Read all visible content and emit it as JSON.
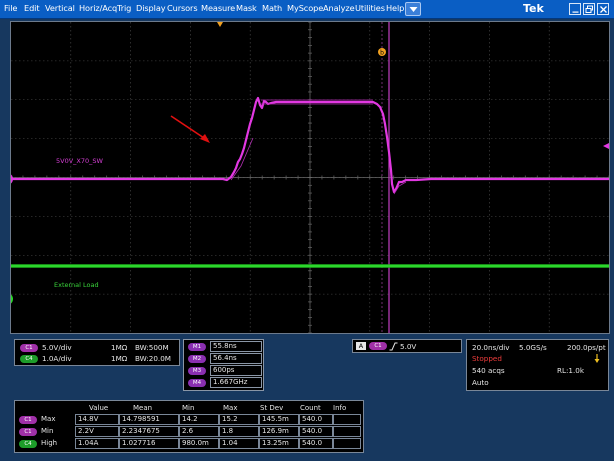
{
  "menu": {
    "items": [
      "File",
      "Edit",
      "Vertical",
      "Horiz/Acq",
      "Trig",
      "Display",
      "Cursors",
      "Measure",
      "Mask",
      "Math",
      "MyScope",
      "Analyze",
      "Utilities",
      "Help"
    ],
    "logo": "Tek"
  },
  "screen": {
    "ch1_label": "5V0V_X70_SW",
    "ch4_label": "External Load",
    "trigger_marker": "T",
    "cursor_marker": "b",
    "ch1_marker": "1",
    "ch4_marker": "4",
    "colors": {
      "ch1": "#e238e2",
      "ch4": "#2cd62c",
      "grid": "#5a5a5a",
      "cursor": "#b53ab5"
    }
  },
  "channels": [
    {
      "badge": "C1",
      "scale": "5.0V/div",
      "impedance": "1MΩ",
      "bandwidth": "BW:500M"
    },
    {
      "badge": "C4",
      "scale": "1.0A/div",
      "impedance": "1MΩ",
      "bandwidth": "BW:20.0M"
    }
  ],
  "measurements": [
    {
      "badge": "M1",
      "value": "55.8ns"
    },
    {
      "badge": "M2",
      "value": "56.4ns"
    },
    {
      "badge": "M3",
      "value": "600ps"
    },
    {
      "badge": "M4",
      "value": "1.667GHz"
    }
  ],
  "trigger": {
    "source": "A",
    "channel": "C1",
    "slope_icon": "rising-edge",
    "level": "5.0V"
  },
  "acquisition": {
    "timebase": "20.0ns/div",
    "sample_rate": "5.0GS/s",
    "resolution": "200.0ps/pt",
    "state": "Stopped",
    "acqs": "540 acqs",
    "record_length": "RL:1.0k",
    "mode": "Auto"
  },
  "stats": {
    "headers": [
      "Value",
      "Mean",
      "Min",
      "Max",
      "St Dev",
      "Count",
      "Info"
    ],
    "rows": [
      {
        "badge": "C1",
        "label": "Max",
        "cells": [
          "14.8V",
          "14.798591",
          "14.2",
          "15.2",
          "145.5m",
          "540.0",
          ""
        ]
      },
      {
        "badge": "C1",
        "label": "Min",
        "cells": [
          "2.2V",
          "2.2347675",
          "2.6",
          "1.8",
          "126.9m",
          "540.0",
          ""
        ]
      },
      {
        "badge": "C4",
        "label": "High",
        "cells": [
          "1.04A",
          "1.027716",
          "980.0m",
          "1.04",
          "13.25m",
          "540.0",
          ""
        ]
      }
    ]
  }
}
